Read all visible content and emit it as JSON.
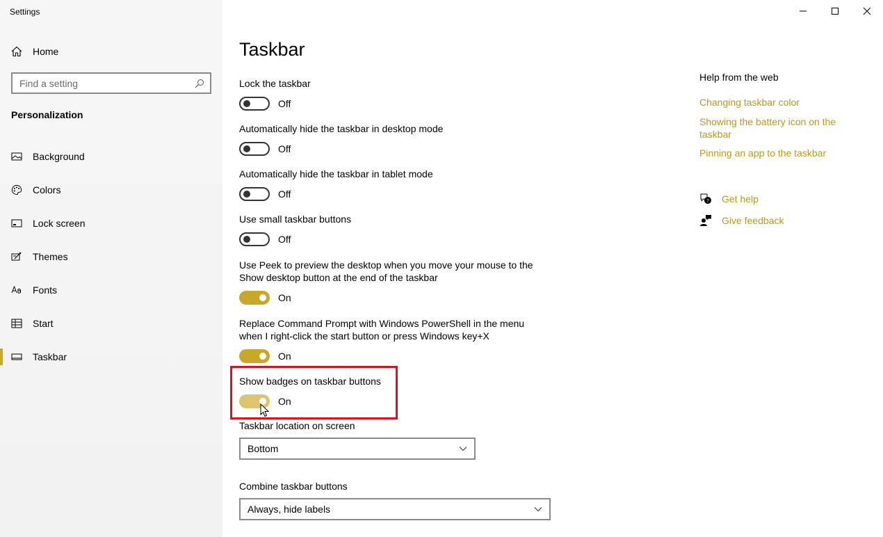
{
  "app": {
    "title": "Settings"
  },
  "sidebar": {
    "home_label": "Home",
    "search_placeholder": "Find a setting",
    "section_title": "Personalization",
    "items": [
      {
        "label": "Background",
        "icon": "picture-icon"
      },
      {
        "label": "Colors",
        "icon": "palette-icon"
      },
      {
        "label": "Lock screen",
        "icon": "lock-screen-icon"
      },
      {
        "label": "Themes",
        "icon": "themes-icon"
      },
      {
        "label": "Fonts",
        "icon": "fonts-icon"
      },
      {
        "label": "Start",
        "icon": "start-icon"
      },
      {
        "label": "Taskbar",
        "icon": "taskbar-icon",
        "active": true
      }
    ]
  },
  "main": {
    "title": "Taskbar",
    "settings": [
      {
        "label": "Lock the taskbar",
        "state": "Off"
      },
      {
        "label": "Automatically hide the taskbar in desktop mode",
        "state": "Off"
      },
      {
        "label": "Automatically hide the taskbar in tablet mode",
        "state": "Off"
      },
      {
        "label": "Use small taskbar buttons",
        "state": "Off"
      },
      {
        "label": "Use Peek to preview the desktop when you move your mouse to the Show desktop button at the end of the taskbar",
        "state": "On"
      },
      {
        "label": "Replace Command Prompt with Windows PowerShell in the menu when I right-click the start button or press Windows key+X",
        "state": "On"
      },
      {
        "label": "Show badges on taskbar buttons",
        "state": "On"
      }
    ],
    "location_label": "Taskbar location on screen",
    "location_value": "Bottom",
    "combine_label": "Combine taskbar buttons",
    "combine_value": "Always, hide labels"
  },
  "help": {
    "title": "Help from the web",
    "links": [
      "Changing taskbar color",
      "Showing the battery icon on the taskbar",
      "Pinning an app to the taskbar"
    ],
    "get_help": "Get help",
    "give_feedback": "Give feedback"
  },
  "colors": {
    "accent": "#c8a828",
    "highlight": "#e0111e"
  }
}
